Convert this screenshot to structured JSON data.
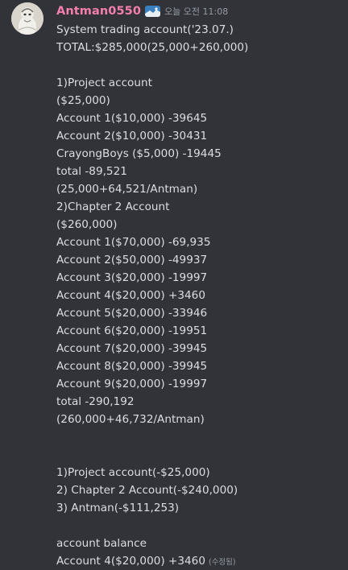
{
  "message": {
    "username": "Antman0550",
    "badge_icon": "server-tag-icon",
    "timestamp": "오늘 오전 11:08",
    "edited_label": "(수정됨)",
    "colors": {
      "background": "#313338",
      "username": "#f47fae",
      "text": "#dbdee1",
      "muted": "#949ba4"
    },
    "lines": [
      "System trading account('23.07.)",
      "TOTAL:$285,000(25,000+260,000)",
      "",
      "1)Project account",
      "($25,000)",
      "Account 1($10,000) -39645",
      "Account 2($10,000) -30431",
      "CrayongBoys ($5,000) -19445",
      "total -89,521",
      "(25,000+64,521/Antman)",
      "2)Chapter 2 Account",
      "($260,000)",
      "Account 1($70,000) -69,935",
      "Account 2($50,000) -49937",
      "Account 3($20,000) -19997",
      "Account 4($20,000) +3460",
      "Account 5($20,000) -33946",
      "Account 6($20,000) -19951",
      "Account 7($20,000) -39945",
      "Account 8($20,000) -39945",
      "Account 9($20,000) -19997",
      "total -290,192",
      "(260,000+46,732/Antman)",
      "",
      "",
      "1)Project account(-$25,000)",
      "2) Chapter 2 Account(-$240,000)",
      "3) Antman(-$111,253)",
      "",
      "account balance",
      "Account 4($20,000) +3460"
    ]
  }
}
